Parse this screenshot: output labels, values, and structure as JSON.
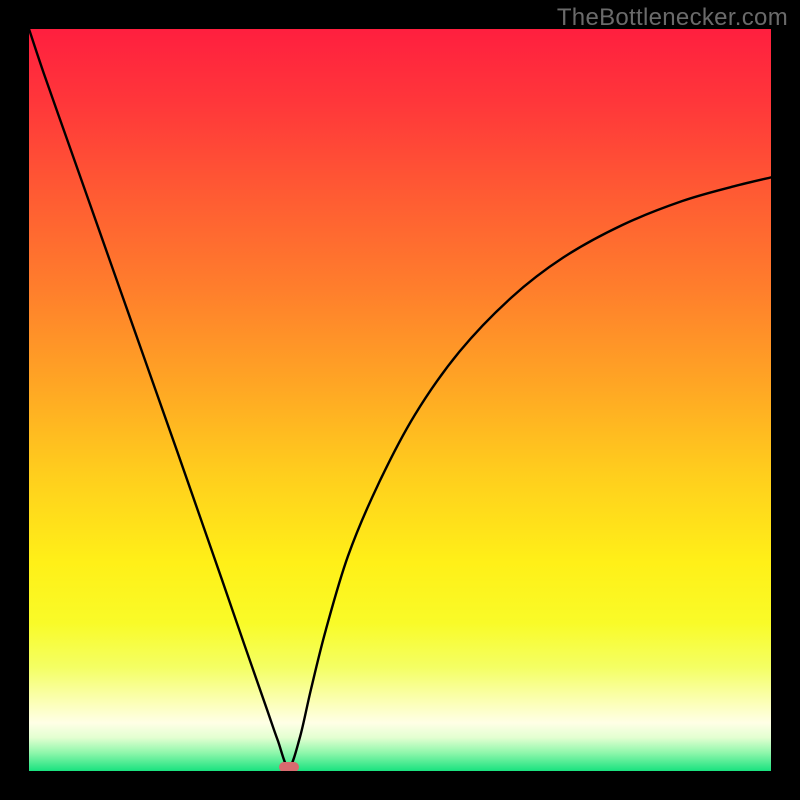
{
  "watermark": {
    "text": "TheBottlenecker.com"
  },
  "chart_data": {
    "type": "line",
    "title": "",
    "xlabel": "",
    "ylabel": "",
    "xlim": [
      0,
      100
    ],
    "ylim": [
      0,
      100
    ],
    "grid": false,
    "legend": false,
    "background_gradient": [
      {
        "stop": 0.0,
        "color": "#ff1f3f"
      },
      {
        "stop": 0.1,
        "color": "#ff373a"
      },
      {
        "stop": 0.22,
        "color": "#ff5a33"
      },
      {
        "stop": 0.35,
        "color": "#ff7e2c"
      },
      {
        "stop": 0.48,
        "color": "#ffa624"
      },
      {
        "stop": 0.6,
        "color": "#ffce1d"
      },
      {
        "stop": 0.72,
        "color": "#fff018"
      },
      {
        "stop": 0.8,
        "color": "#f9fb28"
      },
      {
        "stop": 0.86,
        "color": "#f4ff63"
      },
      {
        "stop": 0.905,
        "color": "#fbffb2"
      },
      {
        "stop": 0.935,
        "color": "#ffffe6"
      },
      {
        "stop": 0.955,
        "color": "#e3ffd1"
      },
      {
        "stop": 0.975,
        "color": "#91f7ac"
      },
      {
        "stop": 1.0,
        "color": "#19e27f"
      }
    ],
    "series": [
      {
        "name": "bottleneck-curve",
        "color": "#000000",
        "x": [
          0,
          2,
          5,
          8,
          11,
          14,
          17,
          20,
          23,
          26,
          29,
          32,
          33.5,
          35,
          36.5,
          38,
          40,
          43,
          47,
          52,
          58,
          65,
          72,
          80,
          88,
          95,
          100
        ],
        "y": [
          100,
          94,
          85.5,
          77,
          68.5,
          60,
          51.5,
          43,
          34.4,
          25.8,
          17.1,
          8.5,
          4.2,
          0.5,
          4.5,
          11,
          19,
          29,
          38.5,
          48,
          56.5,
          63.8,
          69.2,
          73.6,
          76.8,
          78.8,
          80
        ]
      }
    ],
    "annotations": [
      {
        "name": "minimum-marker",
        "x": 35,
        "y": 0.5,
        "color": "#d86a6f"
      }
    ]
  }
}
